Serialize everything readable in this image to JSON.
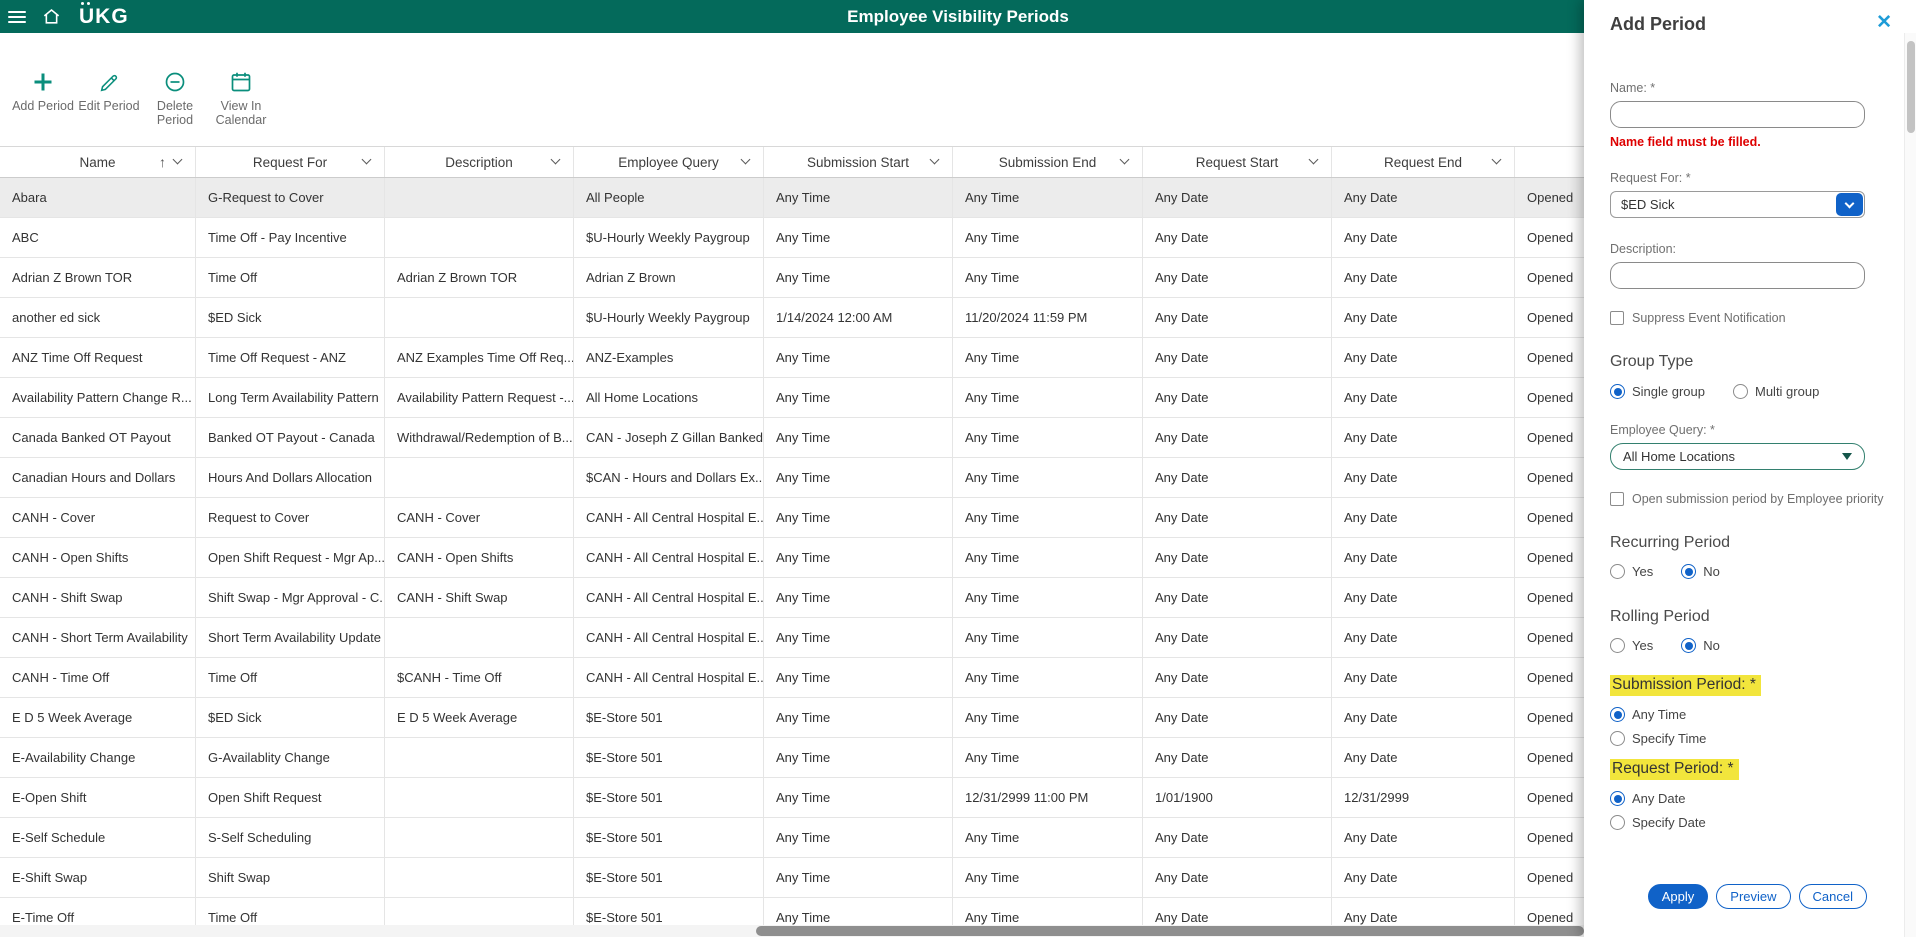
{
  "colors": {
    "header_teal": "#046A5B",
    "icon_teal": "#0A8E7C",
    "accent_blue": "#1062C8",
    "error_red": "#DE0000",
    "highlight_yellow": "#F2E53C"
  },
  "header": {
    "logo": "UKG",
    "title": "Employee Visibility Periods"
  },
  "toolbar": {
    "items": [
      {
        "label": "Add Period",
        "icon": "plus-icon"
      },
      {
        "label": "Edit Period",
        "icon": "pencil-icon"
      },
      {
        "label": "Delete\nPeriod",
        "icon": "circle-minus-icon"
      },
      {
        "label": "View In\nCalendar",
        "icon": "calendar-icon"
      }
    ]
  },
  "table": {
    "columns": [
      "Name",
      "Request For",
      "Description",
      "Employee Query",
      "Submission Start",
      "Submission End",
      "Request Start",
      "Request End",
      ""
    ],
    "sort": {
      "column": "Name",
      "direction": "ascending"
    },
    "rows": [
      [
        "Abara",
        "G-Request to Cover",
        "",
        "All People",
        "Any Time",
        "Any Time",
        "Any Date",
        "Any Date",
        "Opened"
      ],
      [
        "ABC",
        "Time Off - Pay Incentive",
        "",
        "$U-Hourly Weekly Paygroup",
        "Any Time",
        "Any Time",
        "Any Date",
        "Any Date",
        "Opened"
      ],
      [
        "Adrian Z Brown TOR",
        "Time Off",
        "Adrian Z Brown TOR",
        "Adrian Z Brown",
        "Any Time",
        "Any Time",
        "Any Date",
        "Any Date",
        "Opened"
      ],
      [
        "another ed sick",
        "$ED Sick",
        "",
        "$U-Hourly Weekly Paygroup",
        "1/14/2024 12:00 AM",
        "11/20/2024 11:59 PM",
        "Any Date",
        "Any Date",
        "Opened"
      ],
      [
        "ANZ Time Off Request",
        "Time Off Request - ANZ",
        "ANZ Examples Time Off Req...",
        "ANZ-Examples",
        "Any Time",
        "Any Time",
        "Any Date",
        "Any Date",
        "Opened"
      ],
      [
        "Availability Pattern Change R...",
        "Long Term Availability Pattern",
        "Availability Pattern Request -...",
        "All Home Locations",
        "Any Time",
        "Any Time",
        "Any Date",
        "Any Date",
        "Opened"
      ],
      [
        "Canada Banked OT Payout",
        "Banked OT Payout - Canada",
        "Withdrawal/Redemption of B...",
        "CAN - Joseph Z Gillan Banked...",
        "Any Time",
        "Any Time",
        "Any Date",
        "Any Date",
        "Opened"
      ],
      [
        "Canadian Hours and Dollars",
        "Hours And Dollars Allocation",
        "",
        "$CAN - Hours and Dollars Ex...",
        "Any Time",
        "Any Time",
        "Any Date",
        "Any Date",
        "Opened"
      ],
      [
        "CANH - Cover",
        "Request to Cover",
        "CANH - Cover",
        "CANH - All Central Hospital E...",
        "Any Time",
        "Any Time",
        "Any Date",
        "Any Date",
        "Opened"
      ],
      [
        "CANH - Open Shifts",
        "Open Shift Request - Mgr Ap...",
        "CANH - Open Shifts",
        "CANH - All Central Hospital E...",
        "Any Time",
        "Any Time",
        "Any Date",
        "Any Date",
        "Opened"
      ],
      [
        "CANH - Shift Swap",
        "Shift Swap - Mgr Approval - C...",
        "CANH - Shift Swap",
        "CANH - All Central Hospital E...",
        "Any Time",
        "Any Time",
        "Any Date",
        "Any Date",
        "Opened"
      ],
      [
        "CANH - Short Term Availability",
        "Short Term Availability Update",
        "",
        "CANH - All Central Hospital E...",
        "Any Time",
        "Any Time",
        "Any Date",
        "Any Date",
        "Opened"
      ],
      [
        "CANH - Time Off",
        "Time Off",
        "$CANH - Time Off",
        "CANH - All Central Hospital E...",
        "Any Time",
        "Any Time",
        "Any Date",
        "Any Date",
        "Opened"
      ],
      [
        "E D 5 Week Average",
        "$ED Sick",
        "E D 5 Week Average",
        "$E-Store 501",
        "Any Time",
        "Any Time",
        "Any Date",
        "Any Date",
        "Opened"
      ],
      [
        "E-Availability Change",
        "G-Availablity Change",
        "",
        "$E-Store 501",
        "Any Time",
        "Any Time",
        "Any Date",
        "Any Date",
        "Opened"
      ],
      [
        "E-Open Shift",
        "Open Shift Request",
        "",
        "$E-Store 501",
        "Any Time",
        "12/31/2999 11:00 PM",
        "1/01/1900",
        "12/31/2999",
        "Opened"
      ],
      [
        "E-Self Schedule",
        "S-Self Scheduling",
        "",
        "$E-Store 501",
        "Any Time",
        "Any Time",
        "Any Date",
        "Any Date",
        "Opened"
      ],
      [
        "E-Shift Swap",
        "Shift Swap",
        "",
        "$E-Store 501",
        "Any Time",
        "Any Time",
        "Any Date",
        "Any Date",
        "Opened"
      ],
      [
        "E-Time Off",
        "Time Off",
        "",
        "$E-Store 501",
        "Any Time",
        "Any Time",
        "Any Date",
        "Any Date",
        "Opened"
      ]
    ]
  },
  "panel": {
    "title": "Add Period",
    "name": {
      "label": "Name: *",
      "value": "",
      "error": "Name field must be filled."
    },
    "request_for": {
      "label": "Request For: *",
      "value": "$ED Sick"
    },
    "description": {
      "label": "Description:",
      "value": ""
    },
    "suppress_event": {
      "label": "Suppress Event Notification",
      "checked": false
    },
    "group_type": {
      "heading": "Group Type",
      "options": [
        "Single group",
        "Multi group"
      ],
      "selected": "Single group"
    },
    "employee_query": {
      "label": "Employee Query: *",
      "value": "All Home Locations"
    },
    "open_submission": {
      "label": "Open submission period by Employee priority",
      "checked": false
    },
    "recurring_period": {
      "heading": "Recurring Period",
      "options": [
        "Yes",
        "No"
      ],
      "selected": "No"
    },
    "rolling_period": {
      "heading": "Rolling Period",
      "options": [
        "Yes",
        "No"
      ],
      "selected": "No"
    },
    "submission_period": {
      "heading": "Submission Period: *",
      "highlighted": true,
      "options": [
        "Any Time",
        "Specify Time"
      ],
      "selected": "Any Time"
    },
    "request_period": {
      "heading": "Request Period: *",
      "highlighted": true,
      "options": [
        "Any Date",
        "Specify Date"
      ],
      "selected": "Any Date"
    },
    "buttons": {
      "apply": "Apply",
      "preview": "Preview",
      "cancel": "Cancel"
    }
  }
}
